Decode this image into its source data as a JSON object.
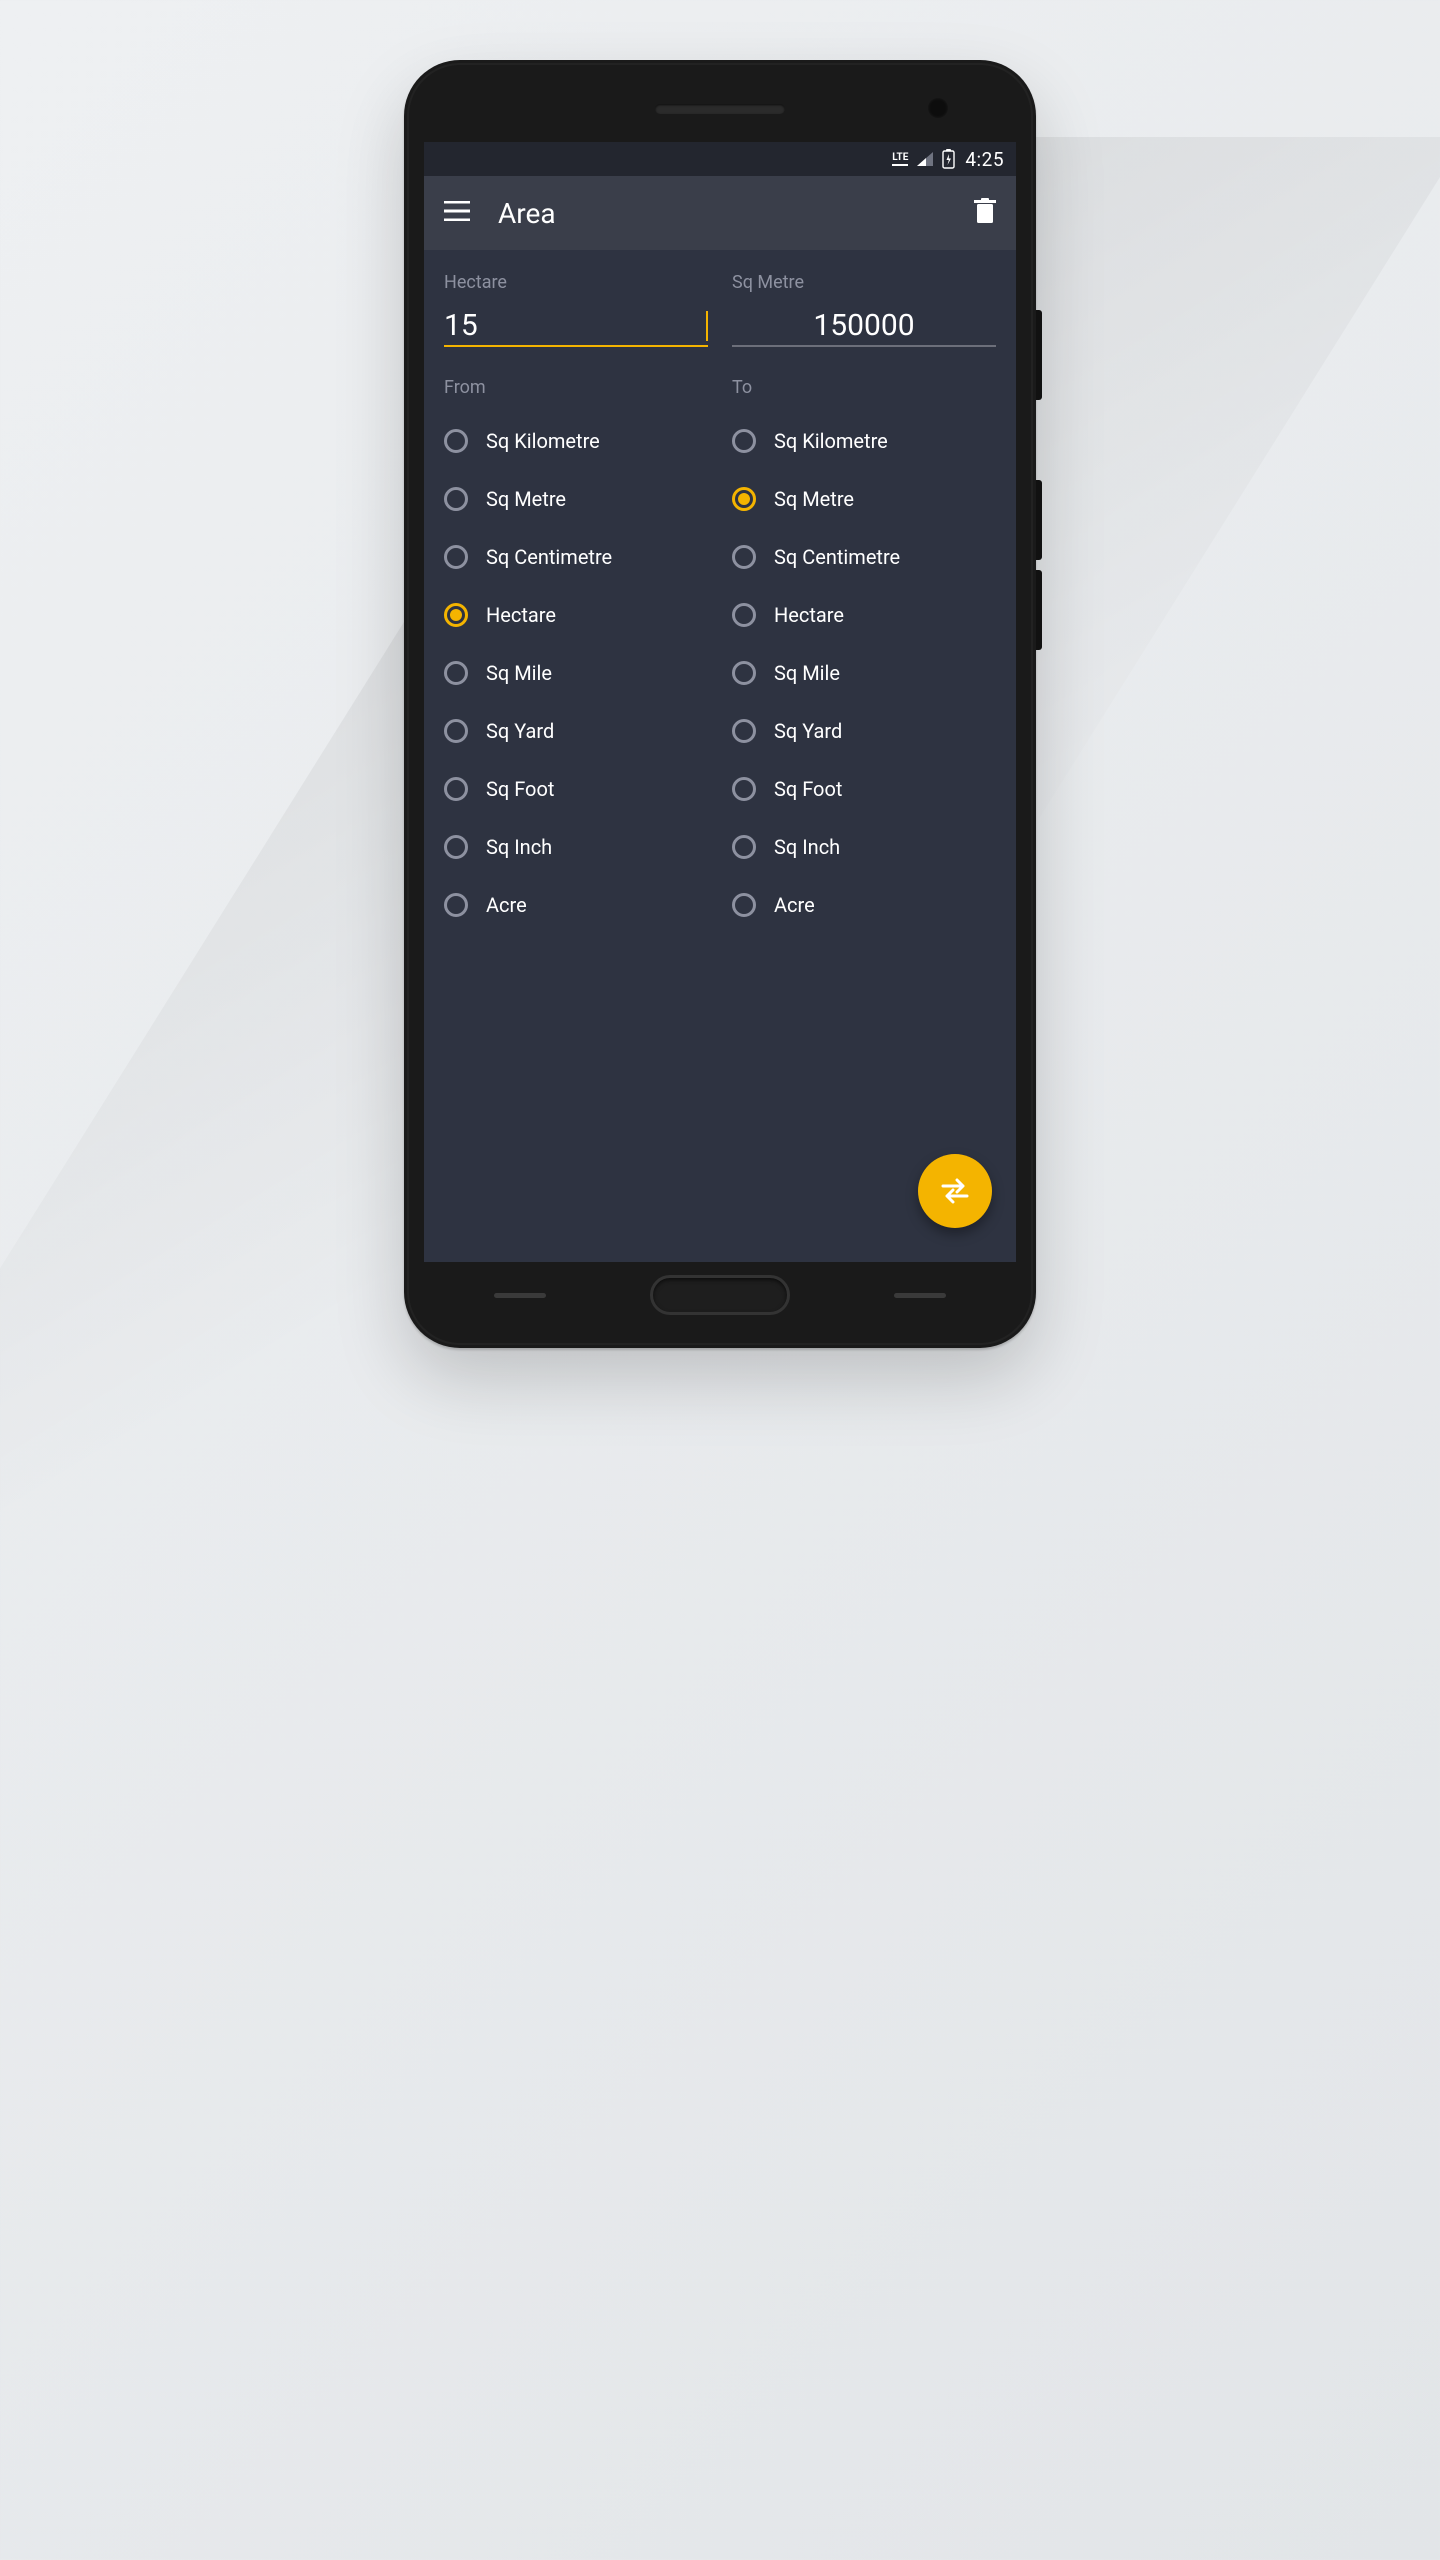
{
  "status": {
    "network": "LTE",
    "time": "4:25"
  },
  "appbar": {
    "title": "Area"
  },
  "from_field": {
    "label": "Hectare",
    "value": "15"
  },
  "to_field": {
    "label": "Sq Metre",
    "value": "150000"
  },
  "sections": {
    "from": "From",
    "to": "To"
  },
  "units": [
    "Sq Kilometre",
    "Sq Metre",
    "Sq Centimetre",
    "Hectare",
    "Sq Mile",
    "Sq Yard",
    "Sq Foot",
    "Sq Inch",
    "Acre"
  ],
  "selection": {
    "from": "Hectare",
    "to": "Sq Metre"
  },
  "colors": {
    "accent": "#f4b400",
    "bg": "#2e3341",
    "bar": "#3a3e4a",
    "muted": "#8d91a0"
  }
}
